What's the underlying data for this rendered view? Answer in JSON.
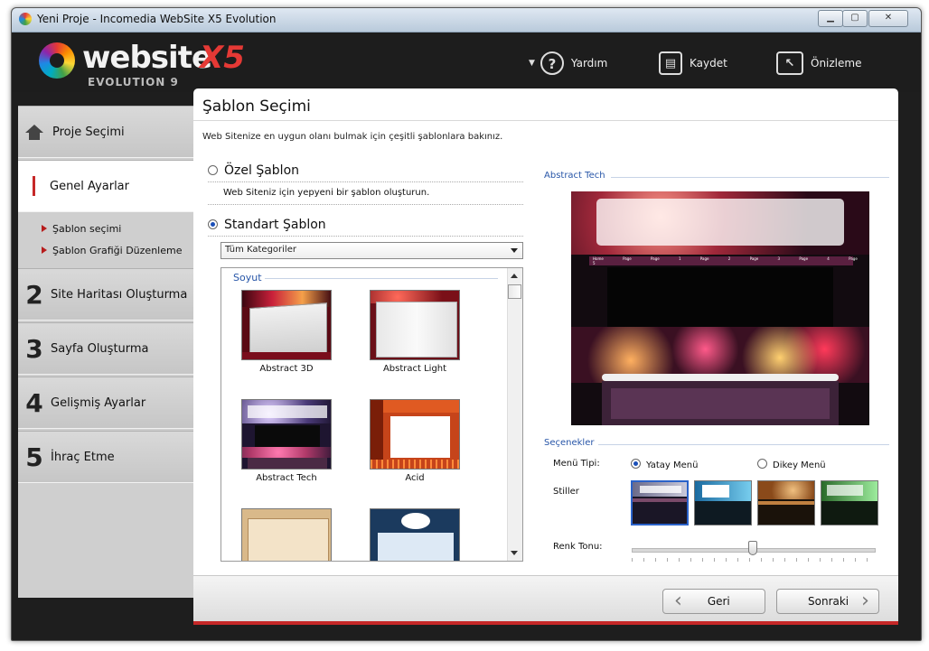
{
  "window": {
    "title": "Yeni Proje - Incomedia WebSite X5 Evolution"
  },
  "logo": {
    "text": "website",
    "x5": "X5",
    "sub": "EVOLUTION 9"
  },
  "toolbar": {
    "help_label": "Yardım",
    "save_label": "Kaydet",
    "preview_label": "Önizleme"
  },
  "nav": {
    "items": [
      {
        "num": "",
        "label": "Proje Seçimi"
      },
      {
        "num": "",
        "label": "Genel Ayarlar"
      },
      {
        "num": "2",
        "label": "Site Haritası Oluşturma"
      },
      {
        "num": "3",
        "label": "Sayfa Oluşturma"
      },
      {
        "num": "4",
        "label": "Gelişmiş Ayarlar"
      },
      {
        "num": "5",
        "label": "İhraç Etme"
      }
    ],
    "subitems": [
      "Şablon seçimi",
      "Şablon Grafiği Düzenleme"
    ]
  },
  "page": {
    "title": "Şablon Seçimi",
    "description": "Web Sitenize en uygun olanı bulmak için çeşitli şablonlara bakınız.",
    "custom": {
      "label": "Özel Şablon",
      "hint": "Web Siteniz için yepyeni bir şablon oluşturun."
    },
    "standard": {
      "label": "Standart Şablon"
    },
    "category_select": "Tüm Kategoriler",
    "gallery": {
      "category": "Soyut",
      "templates": [
        "Abstract 3D",
        "Abstract Light",
        "Abstract Tech",
        "Acid"
      ]
    },
    "preview": {
      "title": "Abstract Tech",
      "menu_items": [
        "Home Page",
        "Page 1",
        "Page 2",
        "Page 3",
        "Page 4",
        "Page 5"
      ]
    },
    "options": {
      "title": "Seçenekler",
      "menu_type_label": "Menü Tipi:",
      "menu_horizontal": "Yatay Menü",
      "menu_vertical": "Dikey Menü",
      "styles_label": "Stiller",
      "tone_label": "Renk Tonu:",
      "tone_value": 0.5
    },
    "buttons": {
      "back": "Geri",
      "next": "Sonraki"
    }
  },
  "colors": {
    "accent": "#c62828",
    "link_blue": "#2856a8"
  }
}
